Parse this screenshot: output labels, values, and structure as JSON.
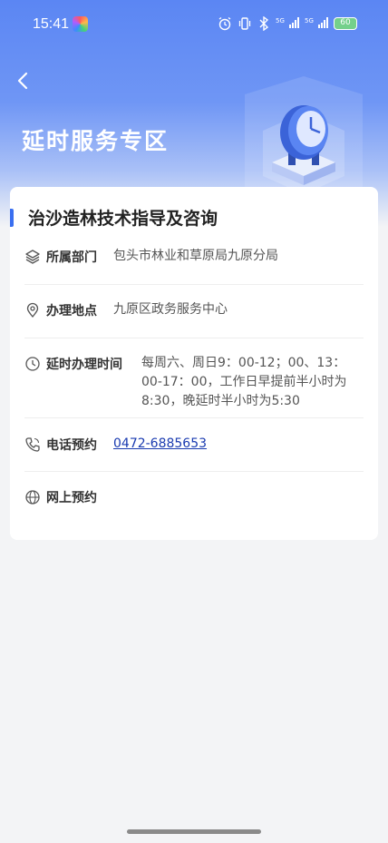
{
  "status_bar": {
    "time": "15:41",
    "signal1_label": "5G",
    "signal2_label": "5G",
    "battery": "60",
    "icons": [
      "app-icon",
      "alarm-icon",
      "vibrate-icon",
      "bluetooth-icon",
      "signal-icon",
      "battery-icon"
    ]
  },
  "header": {
    "back_icon": "chevron-left-icon",
    "title": "延时服务专区"
  },
  "card": {
    "title": "治沙造林技术指导及咨询",
    "department": {
      "label": "所属部门",
      "value": "包头市林业和草原局九原分局",
      "icon": "layers-icon"
    },
    "location": {
      "label": "办理地点",
      "value": "九原区政务服务中心",
      "icon": "location-pin-icon"
    },
    "hours": {
      "label": "延时办理时间",
      "line1": "每周六、周日9：00-12；00、13：",
      "line2": "00-17：00，工作日早提前半小时为",
      "line3": "8:30，晚延时半小时为5:30",
      "icon": "clock-icon"
    },
    "phone": {
      "label": "电话预约",
      "value": "0472-6885653",
      "icon": "phone-icon"
    },
    "online": {
      "label": "网上预约",
      "icon": "globe-icon"
    }
  },
  "colors": {
    "accent": "#3a6ff0",
    "hero": "#5b86f3",
    "link": "#1a3bb0"
  }
}
